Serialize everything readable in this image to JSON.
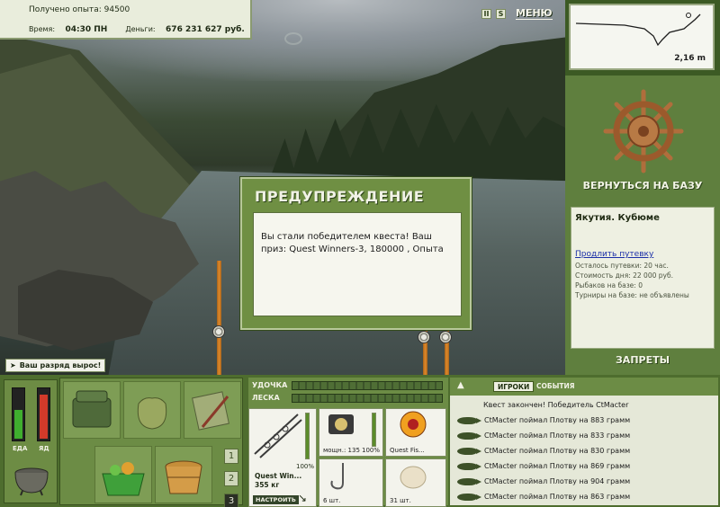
{
  "hud": {
    "xp_label": "Получено опыта:",
    "xp_value": "94500",
    "time_label": "Время:",
    "time_value": "04:30 ПН",
    "money_label": "Деньги:",
    "money_value": "676 231 627 руб."
  },
  "top_controls": {
    "pause_glyph": "II",
    "sound_glyph": "S",
    "menu_label": "МЕНЮ"
  },
  "depth": {
    "value": "2,16 m"
  },
  "base": {
    "return_label": "ВЕРНУТЬСЯ НА БАЗУ",
    "location": "Якутия. Кубюме",
    "buy_link": "Продлить путевку",
    "remaining": "Осталось путевки: 20 час.",
    "day_cost": "Стоимость дня: 22 000 руб.",
    "anglers": "Рыбаков на базе: 0",
    "tournaments": "Турниры на базе: не объявлены",
    "bans_label": "ЗАПРЕТЫ"
  },
  "dialog": {
    "title": "ПРЕДУПРЕЖДЕНИЕ",
    "message": "Вы стали победителем квеста! Ваш приз: Quest Winners-3, 180000 , Опыта"
  },
  "rank_notice": "Ваш разряд вырос!",
  "meters": {
    "food_label": "ЕДА",
    "poison_label": "ЯД",
    "food_level": 0.55,
    "poison_level": 0.85,
    "food_color": "#3fae2e",
    "poison_color": "#d23a2a"
  },
  "inventory": {
    "pages": [
      "1",
      "2",
      "3"
    ],
    "active_page": 2
  },
  "gear": {
    "rod_label": "УДОЧКА",
    "line_label": "ЛЕСКА",
    "rod_name": "Quest Win...",
    "rod_weight": "355 кг",
    "rod_pct": "100%",
    "setup_button": "НАСТРОИТЬ",
    "reel_count": "мощн.: 135",
    "reel_pct": "100%",
    "line_name": "Quest Fis...",
    "hook_count": "6 шт.",
    "bait_count": "31 шт."
  },
  "events": {
    "tab_players": "ИГРОКИ",
    "tab_events": "СОБЫТИЯ",
    "rows": [
      "Квест закончен! Победитель CtMacter",
      "CtMacter поймал Плотву на 883 грамм",
      "CtMacter поймал Плотву на 833 грамм",
      "CtMacter поймал Плотву на 830 грамм",
      "CtMacter поймал Плотву на 869 грамм",
      "CtMacter поймал Плотву на 904 грамм",
      "CtMacter поймал Плотву на 863 грамм"
    ]
  }
}
